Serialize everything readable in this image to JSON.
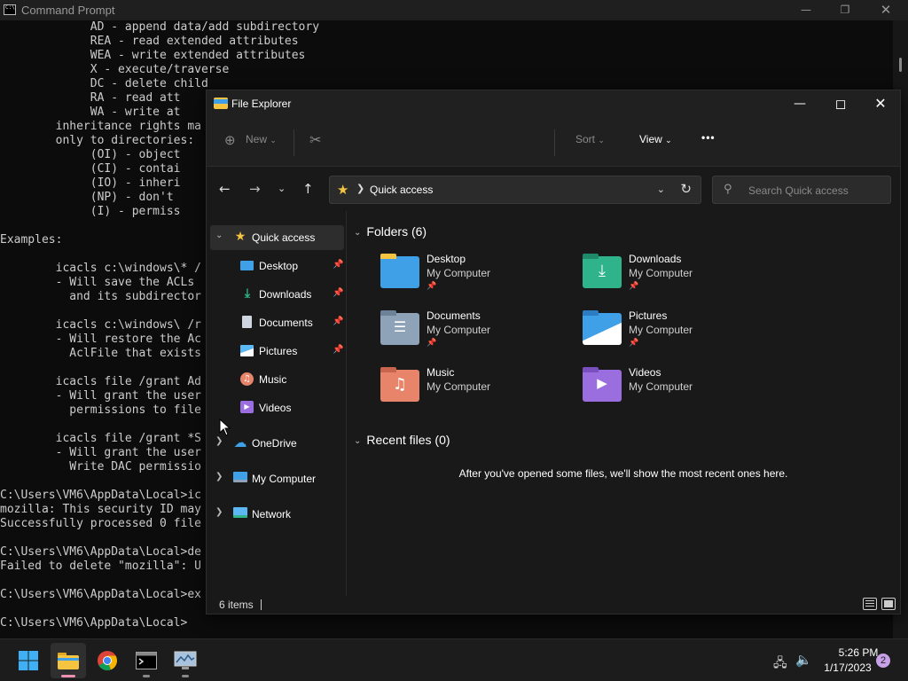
{
  "cmd": {
    "title": "Command Prompt",
    "lines": [
      "             AD - append data/add subdirectory",
      "             REA - read extended attributes",
      "             WEA - write extended attributes",
      "             X - execute/traverse",
      "             DC - delete child",
      "             RA - read att",
      "             WA - write at",
      "        inheritance rights ma",
      "        only to directories:",
      "             (OI) - object",
      "             (CI) - contai",
      "             (IO) - inheri",
      "             (NP) - don't",
      "             (I) - permiss",
      "",
      "Examples:",
      "",
      "        icacls c:\\windows\\* /",
      "        - Will save the ACLs",
      "          and its subdirector",
      "",
      "        icacls c:\\windows\\ /r",
      "        - Will restore the Ac",
      "          AclFile that exists",
      "",
      "        icacls file /grant Ad",
      "        - Will grant the user",
      "          permissions to file",
      "",
      "        icacls file /grant *S",
      "        - Will grant the user",
      "          Write DAC permissio",
      "",
      "C:\\Users\\VM6\\AppData\\Local>ic",
      "mozilla: This security ID may",
      "Successfully processed 0 file",
      "",
      "C:\\Users\\VM6\\AppData\\Local>de",
      "Failed to delete \"mozilla\": U",
      "",
      "C:\\Users\\VM6\\AppData\\Local>ex",
      "",
      "C:\\Users\\VM6\\AppData\\Local>"
    ]
  },
  "explorer": {
    "title": "File Explorer",
    "toolbar": {
      "new_label": "New",
      "sort_label": "Sort",
      "view_label": "View",
      "more_label": "•••"
    },
    "address": {
      "location": "Quick access"
    },
    "search": {
      "placeholder": "Search Quick access"
    },
    "sidebar": {
      "items": [
        {
          "label": "Quick access",
          "icon": "star-icon"
        },
        {
          "label": "Desktop",
          "icon": "desktop-icon"
        },
        {
          "label": "Downloads",
          "icon": "download-icon"
        },
        {
          "label": "Documents",
          "icon": "document-icon"
        },
        {
          "label": "Pictures",
          "icon": "pictures-icon"
        },
        {
          "label": "Music",
          "icon": "music-icon"
        },
        {
          "label": "Videos",
          "icon": "videos-icon"
        },
        {
          "label": "OneDrive",
          "icon": "cloud-icon"
        },
        {
          "label": "My Computer",
          "icon": "computer-icon"
        },
        {
          "label": "Network",
          "icon": "network-icon"
        }
      ]
    },
    "folders_header": "Folders (6)",
    "folders": [
      {
        "name": "Desktop",
        "location": "My Computer",
        "color": "#3fa0e8",
        "pinned": true
      },
      {
        "name": "Downloads",
        "location": "My Computer",
        "color": "#2fb38a",
        "pinned": true
      },
      {
        "name": "Documents",
        "location": "My Computer",
        "color": "#8ea2b8",
        "pinned": true
      },
      {
        "name": "Pictures",
        "location": "My Computer",
        "color": "#3fa0e8",
        "pinned": true
      },
      {
        "name": "Music",
        "location": "My Computer",
        "color": "#e8846a",
        "pinned": false
      },
      {
        "name": "Videos",
        "location": "My Computer",
        "color": "#9b6ee0",
        "pinned": false
      }
    ],
    "recent_header": "Recent files (0)",
    "recent_empty": "After you've opened some files, we'll show the most recent ones here.",
    "status": {
      "items_count": "6 items"
    }
  },
  "taskbar": {
    "apps": [
      {
        "name": "start",
        "icon": "windows-logo-icon"
      },
      {
        "name": "file-explorer",
        "icon": "folder-icon"
      },
      {
        "name": "chrome",
        "icon": "chrome-icon"
      },
      {
        "name": "command-prompt",
        "icon": "terminal-icon"
      },
      {
        "name": "resource-monitor",
        "icon": "monitor-icon"
      }
    ],
    "clock": {
      "time": "5:26 PM",
      "date": "1/17/2023"
    },
    "notification_count": "2"
  }
}
